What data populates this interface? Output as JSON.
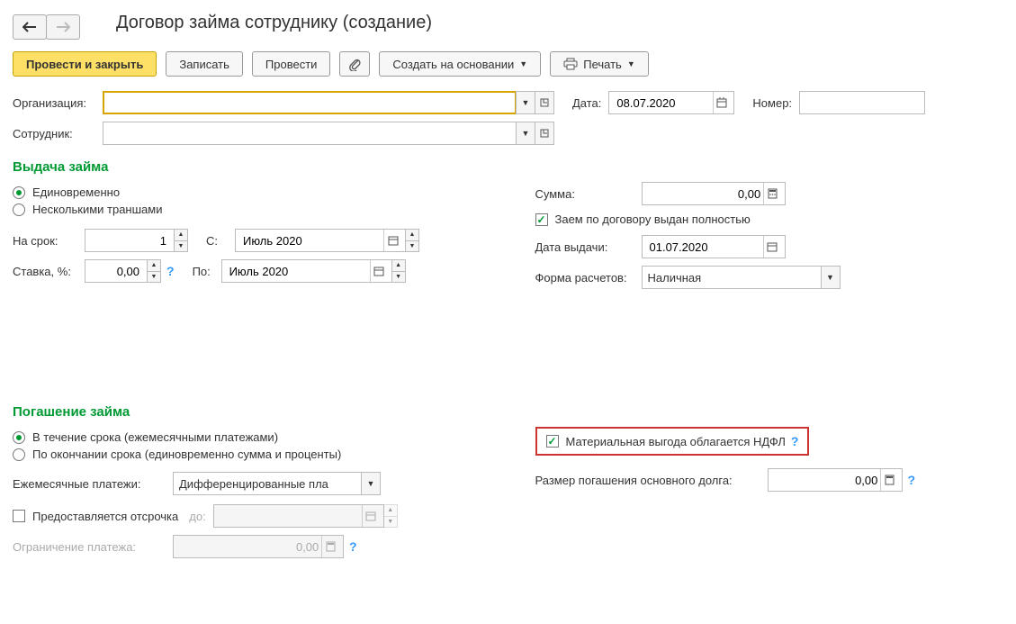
{
  "title": "Договор займа сотруднику (создание)",
  "toolbar": {
    "post_close": "Провести и закрыть",
    "write": "Записать",
    "post": "Провести",
    "create_based": "Создать на основании",
    "print": "Печать"
  },
  "header": {
    "org_label": "Организация:",
    "org_value": "",
    "date_label": "Дата:",
    "date_value": "08.07.2020",
    "number_label": "Номер:",
    "number_value": "",
    "emp_label": "Сотрудник:",
    "emp_value": ""
  },
  "issue": {
    "section": "Выдача займа",
    "opt_once": "Единовременно",
    "opt_tranches": "Несколькими траншами",
    "term_label": "На срок:",
    "term_value": "1",
    "from_label": "С:",
    "from_value": "Июль 2020",
    "rate_label": "Ставка, %:",
    "rate_value": "0,00",
    "to_label": "По:",
    "to_value": "Июль 2020",
    "sum_label": "Сумма:",
    "sum_value": "0,00",
    "fully_issued": "Заем по договору выдан полностью",
    "issue_date_label": "Дата выдачи:",
    "issue_date_value": "01.07.2020",
    "form_label": "Форма расчетов:",
    "form_value": "Наличная"
  },
  "repay": {
    "section": "Погашение займа",
    "opt_during": "В течение срока (ежемесячными платежами)",
    "opt_end": "По окончании срока (единовременно сумма и проценты)",
    "monthly_label": "Ежемесячные платежи:",
    "monthly_value": "Дифференцированные пла",
    "grace_label": "Предоставляется отсрочка",
    "grace_to": "до:",
    "grace_value": "",
    "limit_label": "Ограничение платежа:",
    "limit_value": "0,00",
    "ndfl": "Материальная выгода облагается НДФЛ",
    "principal_label": "Размер погашения основного долга:",
    "principal_value": "0,00"
  },
  "glyphs": {
    "help": "?",
    "check": "✓"
  }
}
